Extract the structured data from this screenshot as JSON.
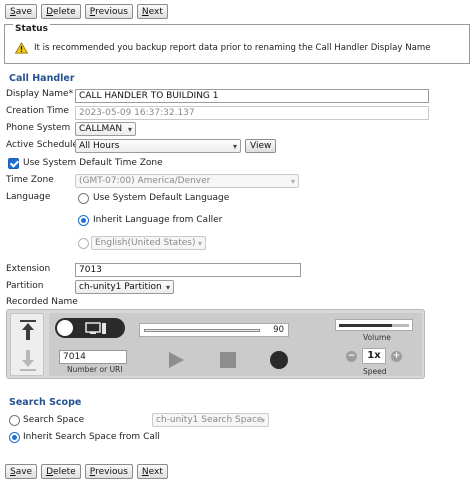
{
  "toolbar": {
    "save": "Save",
    "delete": "Delete",
    "previous": "Previous",
    "next": "Next",
    "save_hotkey": "S",
    "save_rest": "ave",
    "delete_hotkey": "D",
    "delete_rest": "elete",
    "previous_hotkey": "P",
    "previous_rest": "revious",
    "next_hotkey": "N",
    "next_rest": "ext"
  },
  "status": {
    "title": "Status",
    "message": "It is recommended you backup report data prior to renaming the Call Handler Display Name",
    "icon": "warning-icon"
  },
  "call_handler": {
    "section_title": "Call Handler",
    "display_name_label": "Display Name*",
    "display_name_value": "CALL HANDLER TO BUILDING 1",
    "creation_time_label": "Creation Time",
    "creation_time_value": "2023-05-09 16:37:32.137",
    "phone_system_label": "Phone System",
    "phone_system_value": "CALLMAN",
    "active_schedule_label": "Active Schedule",
    "active_schedule_value": "All Hours",
    "view_button": "View",
    "use_default_tz_label": "Use System Default Time Zone",
    "use_default_tz_checked": true,
    "time_zone_label": "Time Zone",
    "time_zone_value": "(GMT-07:00) America/Denver",
    "language_label": "Language",
    "language_options": [
      {
        "label": "Use System Default Language",
        "selected": false
      },
      {
        "label": "Inherit Language from Caller",
        "selected": true
      }
    ],
    "language_select_value": "English(United States)",
    "extension_label": "Extension",
    "extension_value": "7013",
    "partition_label": "Partition",
    "partition_value": "ch-unity1 Partition",
    "recorded_name_label": "Recorded Name"
  },
  "media_player": {
    "progress_value": "90",
    "number_value": "7014",
    "number_caption": "Number or URI",
    "volume_caption": "Volume",
    "volume_level": 0.75,
    "speed_value": "1x",
    "speed_caption": "Speed"
  },
  "search_scope": {
    "section_title": "Search Scope",
    "search_space_label": "Search Space",
    "search_space_value": "ch-unity1 Search Space",
    "inherit_label": "Inherit Search Space from Call",
    "selected": "inherit"
  }
}
